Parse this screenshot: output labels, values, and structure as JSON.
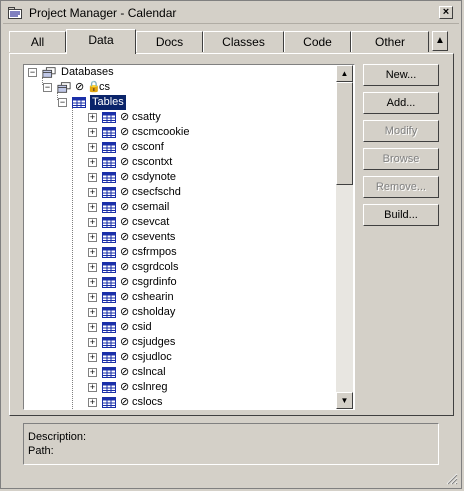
{
  "window": {
    "title": "Project Manager - Calendar",
    "close_label": "×"
  },
  "tabs": [
    {
      "label": "All"
    },
    {
      "label": "Data"
    },
    {
      "label": "Docs"
    },
    {
      "label": "Classes"
    },
    {
      "label": "Code"
    },
    {
      "label": "Other"
    }
  ],
  "active_tab": "Data",
  "tree": {
    "root": "Databases",
    "database": "cs",
    "tables_node": "Tables",
    "tables": [
      "csatty",
      "cscmcookie",
      "csconf",
      "cscontxt",
      "csdynote",
      "csecfschd",
      "csemail",
      "csevcat",
      "csevents",
      "csfrmpos",
      "csgrdcols",
      "csgrdinfo",
      "cshearin",
      "csholday",
      "csid",
      "csjudges",
      "csjudloc",
      "cslncal",
      "cslnreg",
      "cslocs"
    ]
  },
  "buttons": [
    {
      "label": "New...",
      "enabled": true
    },
    {
      "label": "Add...",
      "enabled": true
    },
    {
      "label": "Modify",
      "enabled": false
    },
    {
      "label": "Browse",
      "enabled": false
    },
    {
      "label": "Remove...",
      "enabled": false
    },
    {
      "label": "Build...",
      "enabled": true
    }
  ],
  "description": {
    "description_label": "Description:",
    "path_label": "Path:"
  },
  "colors": {
    "face": "#d4d0c8",
    "selection": "#0a246a",
    "selection_text": "#ffffff",
    "table_icon": "#1a2fa8"
  }
}
